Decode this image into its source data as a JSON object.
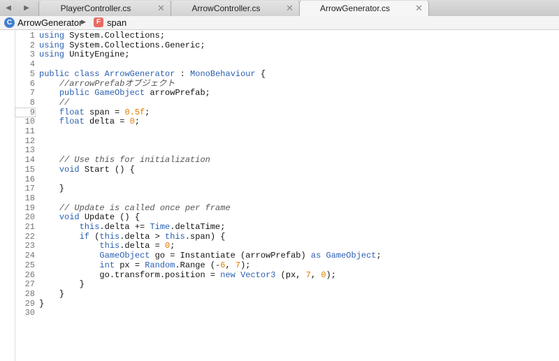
{
  "nav": {
    "back_icon": "chevron-left-icon",
    "forward_icon": "chevron-right-icon"
  },
  "tabs": [
    {
      "label": "PlayerController.cs",
      "close": "✕",
      "active": false
    },
    {
      "label": "ArrowController.cs",
      "close": "✕",
      "active": false
    },
    {
      "label": "ArrowGenerator.cs",
      "close": "✕",
      "active": true
    }
  ],
  "breadcrumb": {
    "class_icon_letter": "C",
    "class_name": "ArrowGenerator",
    "separator": "▶",
    "field_icon_letter": "F",
    "field_name": "span"
  },
  "colors": {
    "keyword": "#2a5fb0",
    "number": "#e07b00",
    "comment": "#555555"
  },
  "code": {
    "cursor_line": 9,
    "lines": [
      "using System.Collections;",
      "using System.Collections.Generic;",
      "using UnityEngine;",
      "",
      "public class ArrowGenerator : MonoBehaviour {",
      "    //arrowPrefabオブジェクト",
      "    public GameObject arrowPrefab;",
      "    //",
      "    float span = 0.5f;",
      "    float delta = 0;",
      "",
      "",
      "",
      "    // Use this for initialization",
      "    void Start () {",
      "",
      "    }",
      "",
      "    // Update is called once per frame",
      "    void Update () {",
      "        this.delta += Time.deltaTime;",
      "        if (this.delta > this.span) {",
      "            this.delta = 0;",
      "            GameObject go = Instantiate (arrowPrefab) as GameObject;",
      "            int px = Random.Range (-6, 7);",
      "            go.transform.position = new Vector3 (px, 7, 0);",
      "        }",
      "    }",
      "}",
      ""
    ]
  }
}
